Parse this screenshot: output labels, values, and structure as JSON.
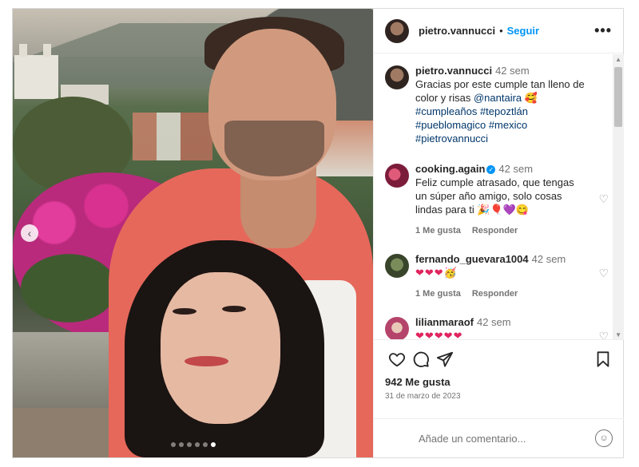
{
  "post": {
    "author": "pietro.vannucci",
    "separator": "•",
    "follow_label": "Seguir",
    "more_label": "•••",
    "image_dots": 6,
    "active_dot": 5
  },
  "caption": {
    "user": "pietro.vannucci",
    "time": "42 sem",
    "text": "Gracias por este cumple tan lleno de color y risas ",
    "mention": "@nantaira",
    "emoji": "🥰",
    "hashtags": [
      "#cumpleaños",
      "#tepoztlán",
      "#pueblomagico",
      "#mexico",
      "#pietrovannucci"
    ]
  },
  "comments": [
    {
      "user": "cooking.again",
      "verified": true,
      "time": "42 sem",
      "text": "Feliz cumple atrasado, que tengas un súper año amigo, solo cosas lindas para ti 🎉🎈💜😋",
      "likes": "1 Me gusta",
      "reply": "Responder"
    },
    {
      "user": "fernando_guevara1004",
      "verified": false,
      "time": "42 sem",
      "text": "❤❤❤🥳",
      "likes": "1 Me gusta",
      "reply": "Responder"
    },
    {
      "user": "lilianmaraof",
      "verified": false,
      "time": "42 sem",
      "text": "❤❤❤❤❤"
    }
  ],
  "stats": {
    "likes": "942 Me gusta",
    "date": "31 de marzo de 2023"
  },
  "add_comment": {
    "placeholder": "Añade un comentario..."
  },
  "icons": {
    "prev": "chevron-left-icon",
    "like": "heart-icon",
    "comment": "comment-icon",
    "share": "send-icon",
    "save": "bookmark-icon",
    "emoji": "emoji-icon"
  },
  "colors": {
    "link": "#0095f6",
    "tag": "#00376b",
    "muted": "#737373",
    "heart": "#e0245e"
  }
}
